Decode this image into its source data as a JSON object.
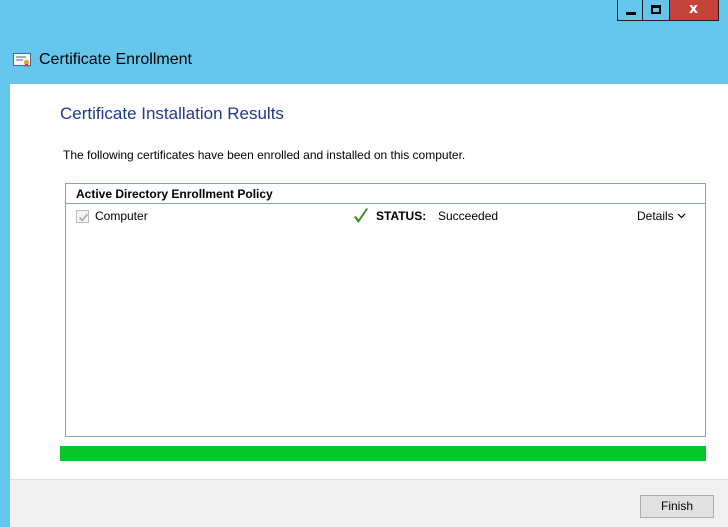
{
  "window": {
    "title": "Certificate Enrollment",
    "controls": {
      "minimize": "minimize",
      "maximize": "maximize",
      "close": "x"
    },
    "accent_color": "#64c6ec",
    "close_color": "#c4443b"
  },
  "page": {
    "heading": "Certificate Installation Results",
    "description": "The following certificates have been enrolled and installed on this computer."
  },
  "policy": {
    "title": "Active Directory Enrollment Policy",
    "certificates": [
      {
        "name": "Computer",
        "checked": true,
        "status_label": "STATUS:",
        "status_value": "Succeeded",
        "status_icon": "green-checkmark-icon",
        "details_label": "Details"
      }
    ]
  },
  "progress": {
    "value": 1.0,
    "color": "#06c62b"
  },
  "footer": {
    "finish_label": "Finish"
  }
}
